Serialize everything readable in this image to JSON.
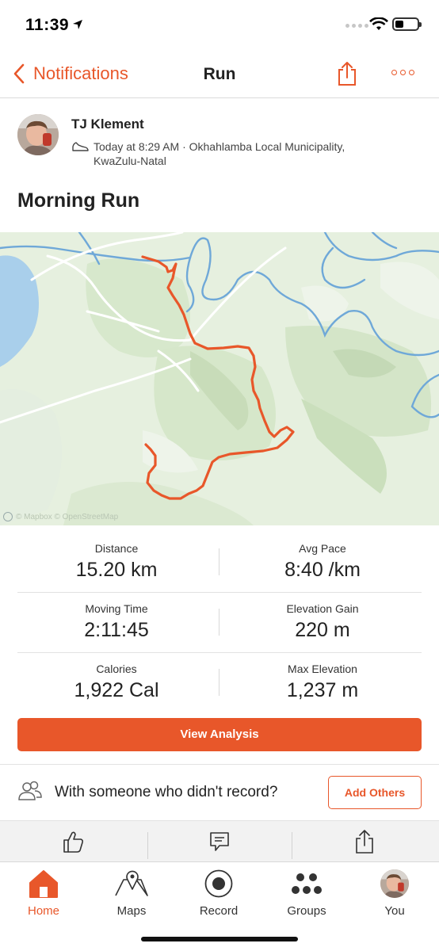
{
  "status_bar": {
    "time": "11:39"
  },
  "nav": {
    "back_label": "Notifications",
    "title": "Run"
  },
  "athlete": {
    "name": "TJ Klement",
    "meta_line1": "Today at 8:29 AM · Okhahlamba Local Municipality,",
    "meta_line2": "KwaZulu-Natal"
  },
  "activity": {
    "title": "Morning Run"
  },
  "map": {
    "attribution": "© Mapbox © OpenStreetMap",
    "route_color": "#e8572a"
  },
  "stats": [
    {
      "left": {
        "label": "Distance",
        "value": "15.20 km"
      },
      "right": {
        "label": "Avg Pace",
        "value": "8:40 /km"
      }
    },
    {
      "left": {
        "label": "Moving Time",
        "value": "2:11:45"
      },
      "right": {
        "label": "Elevation Gain",
        "value": "220 m"
      }
    },
    {
      "left": {
        "label": "Calories",
        "value": "1,922 Cal"
      },
      "right": {
        "label": "Max Elevation",
        "value": "1,237 m"
      }
    }
  ],
  "buttons": {
    "view_analysis": "View Analysis",
    "add_others": "Add Others"
  },
  "with_someone": {
    "text": "With someone who didn't record?"
  },
  "tabs": [
    {
      "label": "Home",
      "icon": "home-icon"
    },
    {
      "label": "Maps",
      "icon": "maps-icon"
    },
    {
      "label": "Record",
      "icon": "record-icon"
    },
    {
      "label": "Groups",
      "icon": "groups-icon"
    },
    {
      "label": "You",
      "icon": "avatar"
    }
  ],
  "colors": {
    "accent": "#e8572a",
    "water": "#6fa8d8",
    "land": "#e8f2e1"
  }
}
